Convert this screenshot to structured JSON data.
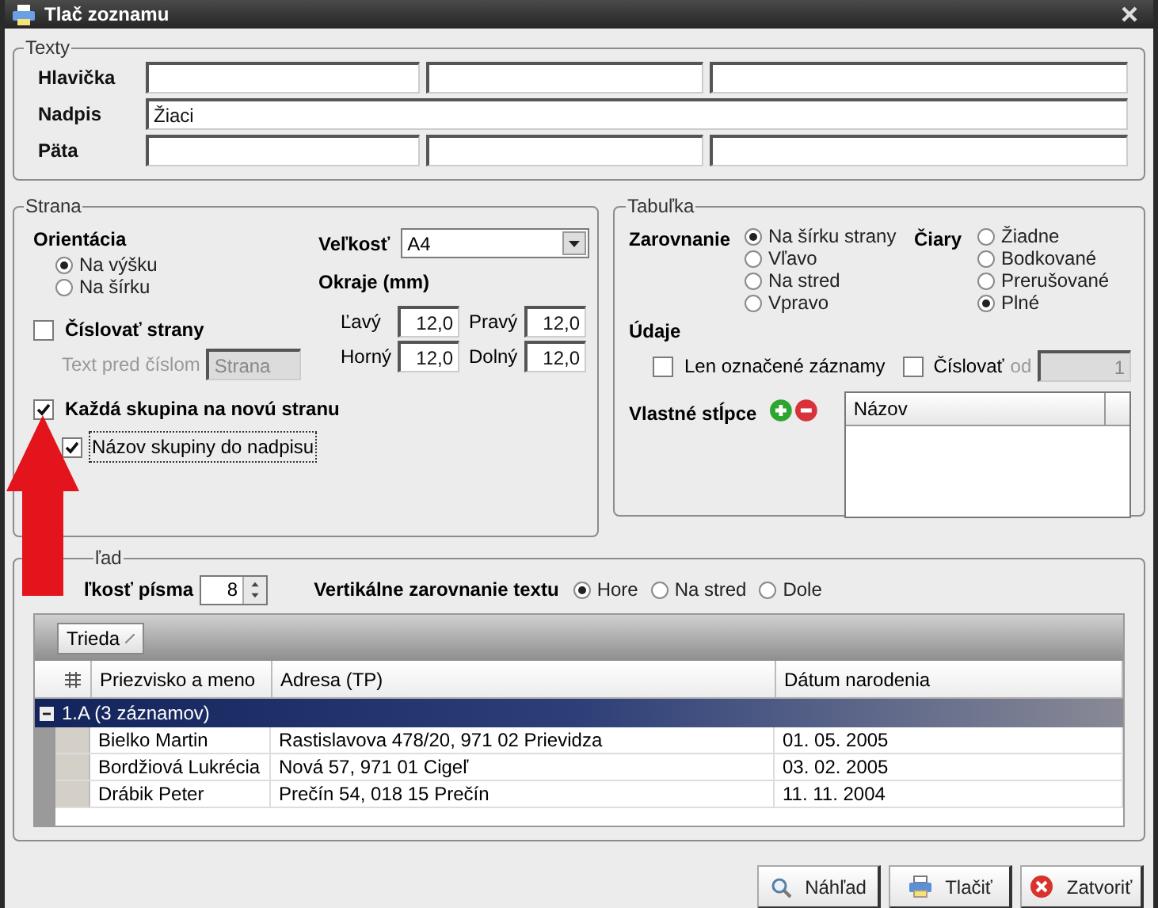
{
  "window": {
    "title": "Tlač zoznamu"
  },
  "texty": {
    "legend": "Texty",
    "rows": [
      {
        "label": "Hlavička",
        "kind": "three"
      },
      {
        "label": "Nadpis",
        "kind": "one",
        "value": "Žiaci"
      },
      {
        "label": "Päta",
        "kind": "three"
      }
    ]
  },
  "strana": {
    "legend": "Strana",
    "orientation": {
      "label": "Orientácia",
      "options": [
        {
          "label": "Na výšku",
          "selected": true
        },
        {
          "label": "Na šírku",
          "selected": false
        }
      ]
    },
    "size": {
      "label": "Veľkosť",
      "value": "A4"
    },
    "margins": {
      "label": "Okraje (mm)",
      "fields": [
        {
          "label": "Ľavý",
          "value": "12,0"
        },
        {
          "label": "Pravý",
          "value": "12,0"
        },
        {
          "label": "Horný",
          "value": "12,0"
        },
        {
          "label": "Dolný",
          "value": "12,0"
        }
      ]
    },
    "page_numbers": {
      "label": "Číslovať strany",
      "checked": false,
      "prefix_label": "Text pred číslom",
      "prefix_value": "Strana",
      "disabled": true
    },
    "group_new_page": {
      "label": "Každá skupina na novú stranu",
      "checked": true
    },
    "group_name_title": {
      "label": "Názov skupiny do nadpisu",
      "checked": true
    }
  },
  "tabulka": {
    "legend": "Tabuľka",
    "alignment": {
      "label": "Zarovnanie",
      "options": [
        {
          "label": "Na šírku strany",
          "selected": true
        },
        {
          "label": "Vľavo",
          "selected": false
        },
        {
          "label": "Na stred",
          "selected": false
        },
        {
          "label": "Vpravo",
          "selected": false
        }
      ]
    },
    "lines": {
      "label": "Čiary",
      "options": [
        {
          "label": "Žiadne",
          "selected": false
        },
        {
          "label": "Bodkované",
          "selected": false
        },
        {
          "label": "Prerušované",
          "selected": false
        },
        {
          "label": "Plné",
          "selected": true
        }
      ]
    },
    "data": {
      "label": "Údaje",
      "only_marked": {
        "label": "Len označené záznamy",
        "checked": false
      },
      "numbering": {
        "label": "Číslovať",
        "checked": false,
        "from_label": "od",
        "from_value": "1",
        "disabled": true
      }
    },
    "custom_columns": {
      "label": "Vlastné stĺpce",
      "column": "Názov"
    }
  },
  "nahlad": {
    "legend": "ľad",
    "font_size": {
      "label": "ľkosť písma",
      "value": "8"
    },
    "valign": {
      "label": "Vertikálne zarovnanie textu",
      "options": [
        {
          "label": "Hore",
          "selected": true
        },
        {
          "label": "Na stred",
          "selected": false
        },
        {
          "label": "Dole",
          "selected": false
        }
      ]
    },
    "group_chip": "Trieda",
    "table": {
      "columns": [
        "Priezvisko a meno",
        "Adresa (TP)",
        "Dátum narodenia"
      ],
      "group": {
        "label": "1.A (3 záznamov)",
        "expanded": true
      },
      "rows": [
        [
          "Bielko Martin",
          "Rastislavova 478/20, 971 02 Prievidza",
          "01. 05. 2005"
        ],
        [
          "Bordžiová Lukrécia",
          "Nová 57, 971 01 Cigeľ",
          "03. 02. 2005"
        ],
        [
          "Drábik Peter",
          "Prečín 54, 018 15 Prečín",
          "11. 11. 2004"
        ]
      ]
    }
  },
  "buttons": [
    {
      "label": "Náhľad",
      "kind": "preview"
    },
    {
      "label": "Tlačiť",
      "kind": "print"
    },
    {
      "label": "Zatvoriť",
      "kind": "close"
    }
  ]
}
